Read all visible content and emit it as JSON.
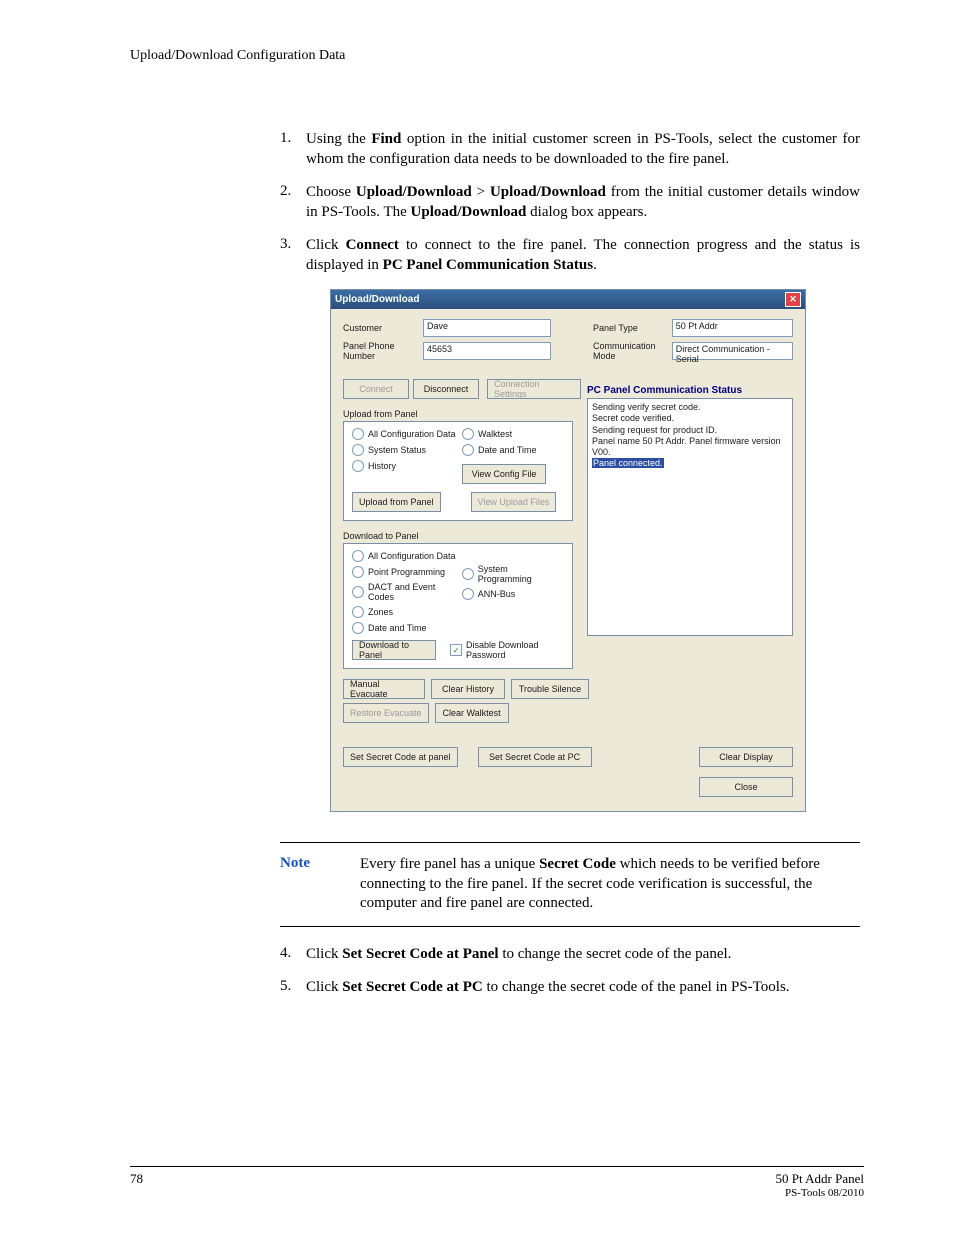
{
  "header_running": "Upload/Download Configuration Data",
  "steps_a": [
    {
      "n": "1.",
      "parts": [
        "Using the ",
        {
          "b": "Find"
        },
        " option in the initial customer screen in PS-Tools, select the customer for whom the configuration data needs to be downloaded to the fire panel."
      ]
    },
    {
      "n": "2.",
      "parts": [
        "Choose ",
        {
          "b": "Upload/Download"
        },
        " > ",
        {
          "b": "Upload/Download"
        },
        " from the initial customer details window in PS-Tools. The ",
        {
          "b": "Upload/Download"
        },
        " dialog box appears."
      ]
    },
    {
      "n": "3.",
      "parts": [
        "Click ",
        {
          "b": "Connect"
        },
        " to connect to the fire panel. The connection progress and the status is displayed in ",
        {
          "b": "PC Panel Communication Status"
        },
        "."
      ]
    }
  ],
  "dialog": {
    "title": "Upload/Download",
    "customer_lbl": "Customer",
    "customer_val": "Dave",
    "phone_lbl": "Panel Phone Number",
    "phone_val": "45653",
    "panel_type_lbl": "Panel Type",
    "panel_type_val": "50 Pt Addr",
    "comm_mode_lbl": "Communication Mode",
    "comm_mode_val": "Direct Communication - Serial",
    "btn_connect": "Connect",
    "btn_disconnect": "Disconnect",
    "btn_conn_settings": "Connection Settings",
    "sec_upload": "Upload from Panel",
    "up_r1": [
      "All Configuration Data",
      "System Status",
      "History"
    ],
    "up_r2": [
      "Walktest",
      "Date and Time"
    ],
    "btn_view_config": "View Config File",
    "btn_upload_from_panel": "Upload from Panel",
    "btn_view_upload": "View Upload Files",
    "sec_download": "Download to Panel",
    "dl_r1": [
      "All Configuration Data",
      "Point Programming",
      "DACT and Event Codes",
      "Zones",
      "Date and Time"
    ],
    "dl_r2": [
      "System Programming",
      "ANN-Bus"
    ],
    "btn_download_to_panel": "Download to Panel",
    "chk_disable_pwd": "Disable Download Password",
    "btn_manual_evac": "Manual Evacuate",
    "btn_clear_history": "Clear History",
    "btn_trouble_silence": "Trouble Silence",
    "btn_restore_evac": "Restore Evacuate",
    "btn_clear_walktest": "Clear Walktest",
    "stat_header": "PC Panel Communication Status",
    "stat_lines": [
      "Sending verify secret code.",
      "Secret code verified.",
      "Sending request for product ID.",
      "Panel name 50 Pt Addr. Panel firmware version V00."
    ],
    "stat_highlight": "Panel connected.",
    "btn_clear_display": "Clear Display",
    "btn_secret_panel": "Set Secret Code at panel",
    "btn_secret_pc": "Set Secret Code at PC",
    "btn_close": "Close"
  },
  "note_label": "Note",
  "note_parts": [
    "Every fire panel has a unique ",
    {
      "b": "Secret Code"
    },
    " which needs to be verified before connecting to the fire panel. If the secret code verification is successful, the computer and fire panel are connected."
  ],
  "steps_b": [
    {
      "n": "4.",
      "parts": [
        "Click ",
        {
          "b": "Set Secret Code at Panel"
        },
        " to change the secret code of the panel."
      ]
    },
    {
      "n": "5.",
      "parts": [
        "Click ",
        {
          "b": "Set Secret Code at PC"
        },
        " to change the secret code of the panel in PS-Tools."
      ]
    }
  ],
  "footer": {
    "page": "78",
    "title": "50 Pt Addr Panel",
    "sub": "PS-Tools 08/2010"
  }
}
